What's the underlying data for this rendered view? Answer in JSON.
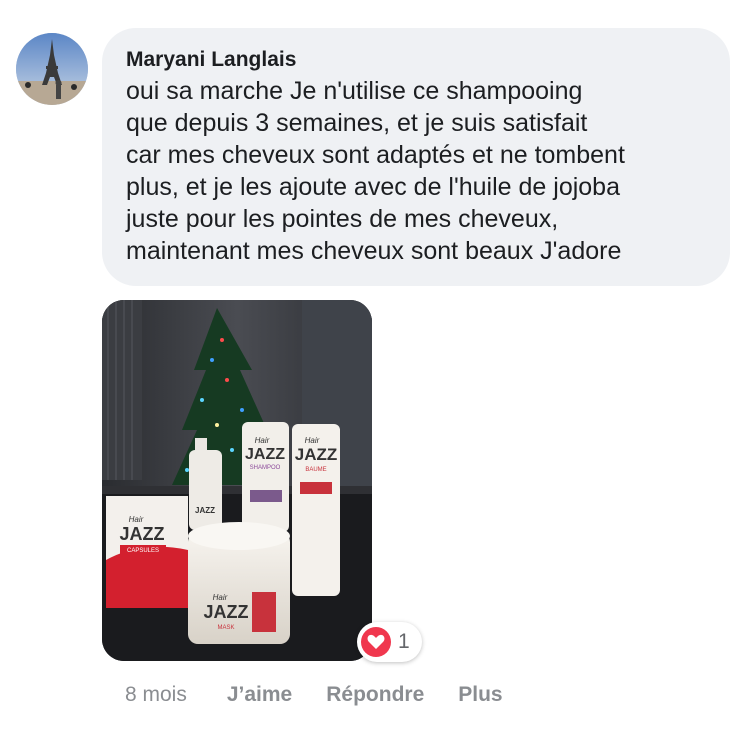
{
  "comment": {
    "author": "Maryani Langlais",
    "text_lines": [
      "oui sa marche Je n'utilise ce shampooing",
      "que depuis 3 semaines, et je suis satisfait",
      "car mes cheveux sont adaptés et ne tombent",
      "plus, et je les ajoute avec de l'huile de jojoba",
      "juste pour les pointes de mes cheveux,",
      "maintenant mes cheveux sont beaux J'adore"
    ]
  },
  "photo": {
    "product_labels": {
      "brand_small": "Hair",
      "brand": "JAZZ",
      "box_line": "CAPSULES",
      "shampoo_line": "SHAMPOO",
      "baume_line": "BAUME",
      "mask_line": "MASK"
    }
  },
  "reaction": {
    "icon": "heart-icon",
    "count": "1",
    "color": "#f0374e"
  },
  "actions": {
    "time": "8 mois",
    "like": "J’aime",
    "reply": "Répondre",
    "more": "Plus"
  }
}
